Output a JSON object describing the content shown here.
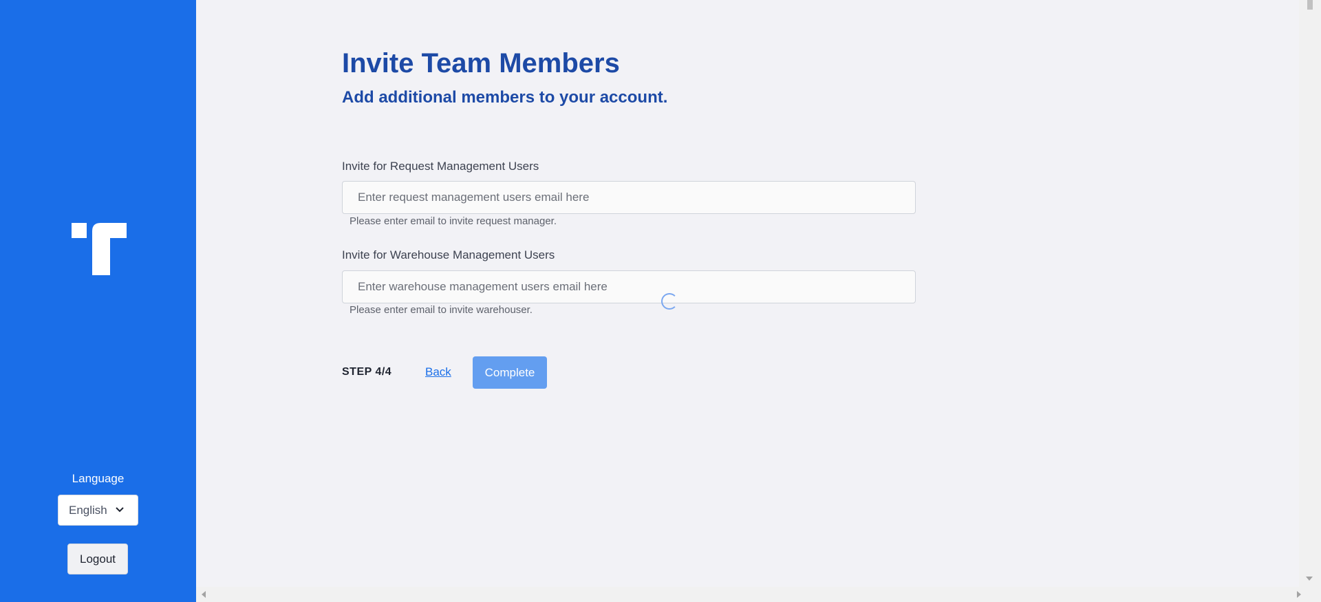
{
  "sidebar": {
    "logo_icon": "brand-t-logo-icon",
    "language_label": "Language",
    "language_selected": "English",
    "language_chevron_icon": "chevron-down-icon",
    "logout_label": "Logout"
  },
  "main": {
    "title": "Invite Team Members",
    "subtitle": "Add additional members to your account.",
    "request_field": {
      "label": "Invite for Request Management Users",
      "value": "",
      "placeholder": "Enter request management users email here",
      "help": "Please enter email to invite request manager."
    },
    "warehouse_field": {
      "label": "Invite for Warehouse Management Users",
      "value": "",
      "placeholder": "Enter warehouse management users email here",
      "help": "Please enter email to invite warehouser."
    },
    "loading_icon": "loading-spinner-icon",
    "step": "STEP 4/4",
    "back_label": "Back",
    "complete_label": "Complete"
  },
  "colors": {
    "sidebar_bg": "#1a6ee8",
    "page_bg": "#f2f2f6",
    "heading": "#1d4aa6",
    "button_primary": "#639ef0",
    "link": "#1a6ee8"
  }
}
